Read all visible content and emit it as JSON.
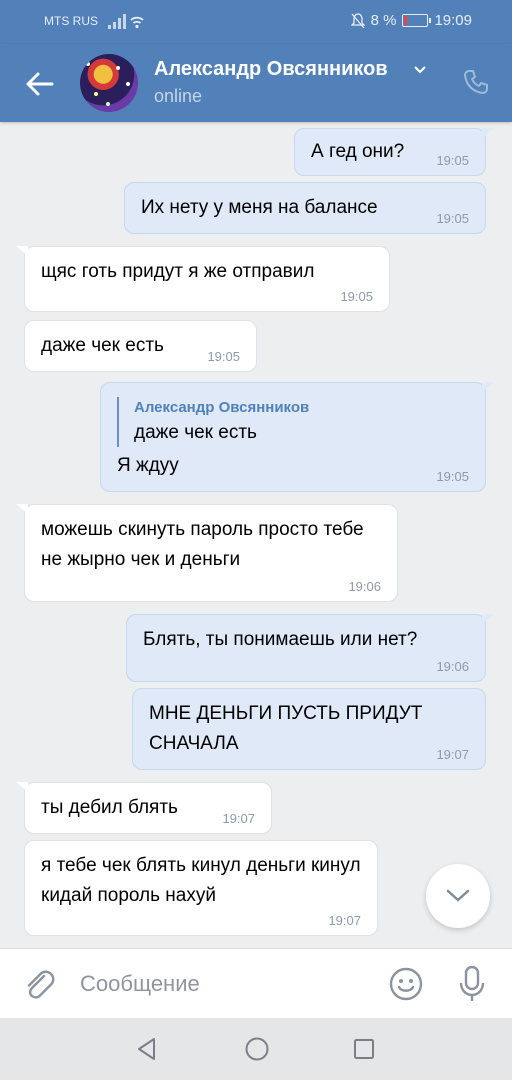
{
  "statusbar": {
    "carrier": "MTS RUS",
    "battery": "8 %",
    "time": "19:09"
  },
  "header": {
    "name": "Александр Овсянников",
    "status": "online"
  },
  "messages": [
    {
      "dir": "out",
      "text": "А гед они?",
      "time": "19:05"
    },
    {
      "dir": "out",
      "text": "Их нету у меня на балансе",
      "time": "19:05"
    },
    {
      "dir": "in",
      "text": "щяс готь придут я же отправил",
      "time": "19:05"
    },
    {
      "dir": "in",
      "text": "даже чек есть",
      "time": "19:05"
    },
    {
      "dir": "out",
      "reply_name": "Александр Овсянников",
      "reply_text": "даже чек есть",
      "text": "Я ждуу",
      "time": "19:05"
    },
    {
      "dir": "in",
      "text": "можешь скинуть пароль просто тебе не жырно чек и деньги",
      "time": "19:06"
    },
    {
      "dir": "out",
      "text": "Блять, ты понимаешь или нет?",
      "time": "19:06"
    },
    {
      "dir": "out",
      "text": "МНЕ ДЕНЬГИ ПУСТЬ ПРИДУТ СНАЧАЛА",
      "time": "19:07"
    },
    {
      "dir": "in",
      "text": "ты дебил блять",
      "time": "19:07"
    },
    {
      "dir": "in",
      "text": "я тебе чек блять кинул деньги кинул кидай пороль нахуй",
      "time": "19:07"
    }
  ],
  "input": {
    "placeholder": "Сообщение",
    "value": ""
  },
  "icons": {
    "back": "arrow-left-icon",
    "chevron": "chevron-down-icon",
    "call": "phone-icon",
    "attach": "paperclip-icon",
    "emoji": "smiley-icon",
    "mic": "microphone-icon",
    "scroll": "chevron-down-icon",
    "nav_back": "triangle-back-icon",
    "nav_home": "circle-home-icon",
    "nav_recent": "square-recent-icon"
  },
  "colors": {
    "header": "#5181b8",
    "outgoing": "#dfe9f7",
    "incoming": "#ffffff",
    "background": "#edeef0"
  }
}
